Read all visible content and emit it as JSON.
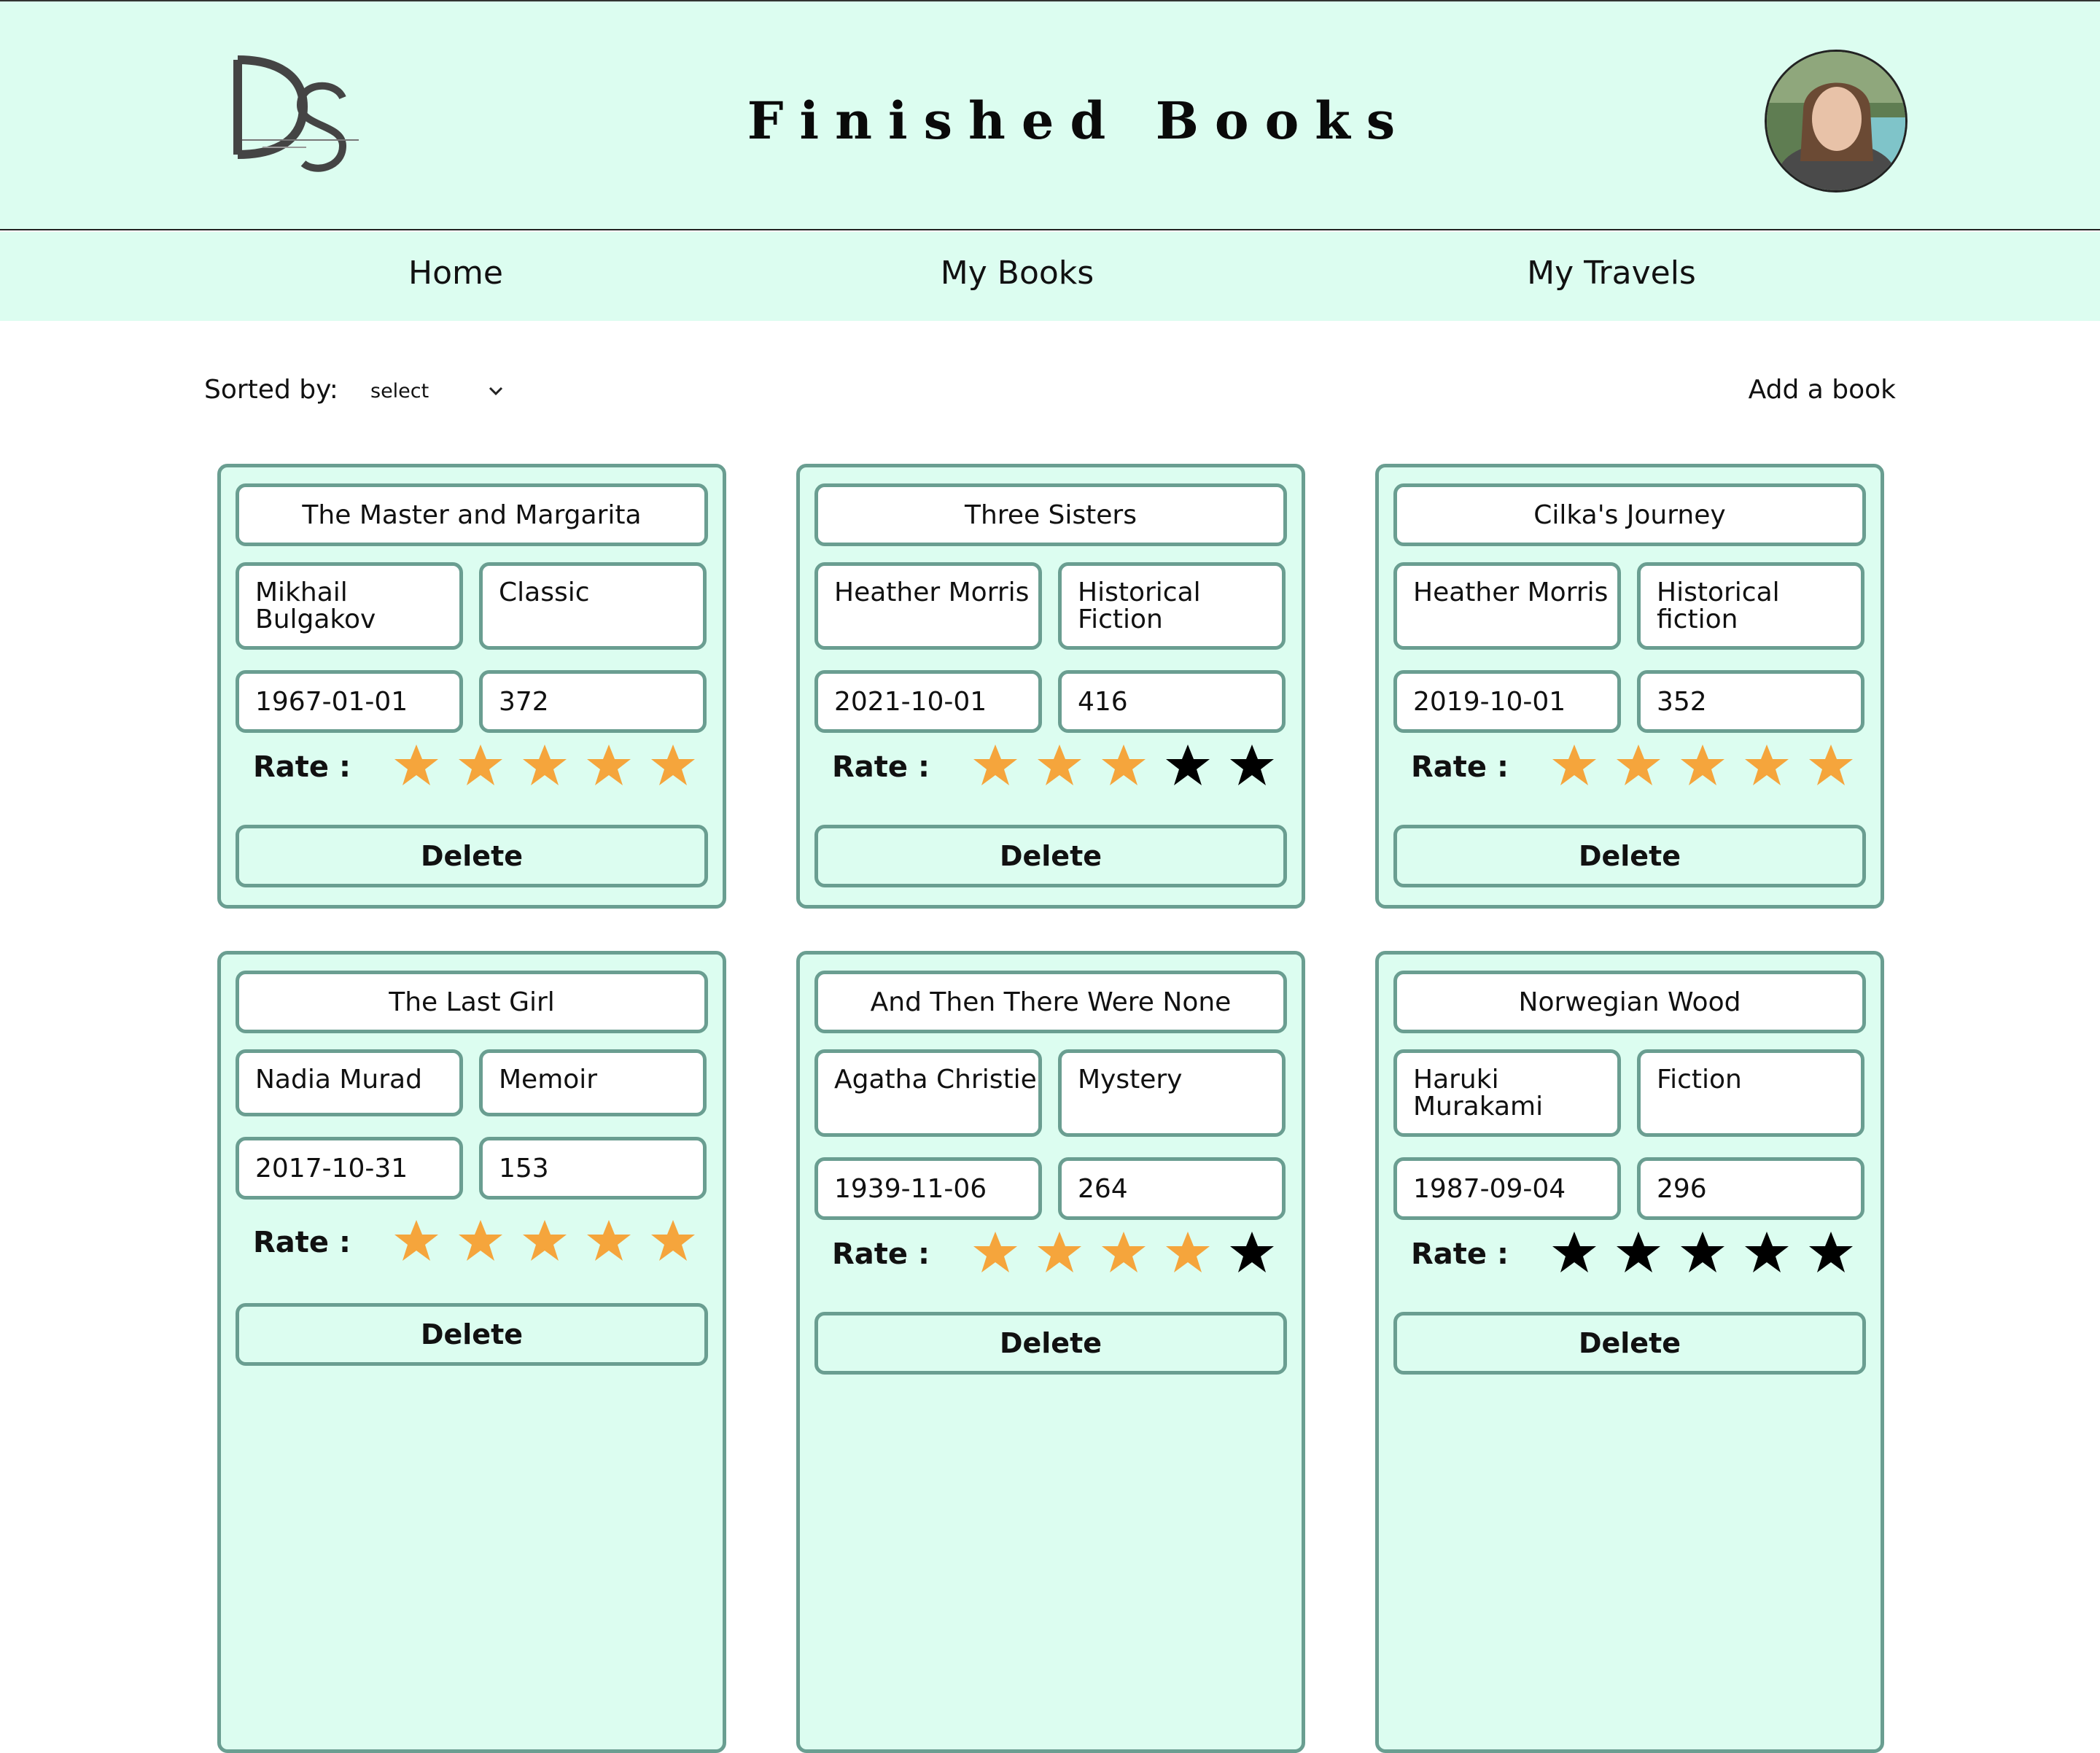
{
  "header": {
    "title": "Finished Books",
    "logo_icon": "ds-monogram-logo",
    "avatar_icon": "profile-photo"
  },
  "nav": {
    "items": [
      {
        "label": "Home"
      },
      {
        "label": "My Books"
      },
      {
        "label": "My Travels"
      }
    ]
  },
  "toolbar": {
    "sort_label": "Sorted by:",
    "sort_select": {
      "selected": "select"
    },
    "add_book_label": "Add a book"
  },
  "colors": {
    "accent_bg": "#dcfdf0",
    "card_border": "#6a9e91",
    "star_active": "#f5a53c",
    "star_inactive": "#000000"
  },
  "rate_label": "Rate :",
  "delete_label": "Delete",
  "books": [
    {
      "title": "The Master and Margarita",
      "author": "Mikhail Bulgakov",
      "genre": "Classic",
      "date": "1967-01-01",
      "pages": "372",
      "rating": 5
    },
    {
      "title": "Three Sisters",
      "author": "Heather Morris",
      "genre": "Historical Fiction",
      "date": "2021-10-01",
      "pages": "416",
      "rating": 3
    },
    {
      "title": "Cilka's Journey",
      "author": "Heather Morris",
      "genre": "Historical fiction",
      "date": "2019-10-01",
      "pages": "352",
      "rating": 5
    },
    {
      "title": "The Last Girl",
      "author": "Nadia Murad",
      "genre": "Memoir",
      "date": "2017-10-31",
      "pages": "153",
      "rating": 5
    },
    {
      "title": "And Then There Were None",
      "author": "Agatha Christie",
      "genre": "Mystery",
      "date": "1939-11-06",
      "pages": "264",
      "rating": 4
    },
    {
      "title": "Norwegian Wood",
      "author": "Haruki Murakami",
      "genre": "Fiction",
      "date": "1987-09-04",
      "pages": "296",
      "rating": 0
    }
  ]
}
